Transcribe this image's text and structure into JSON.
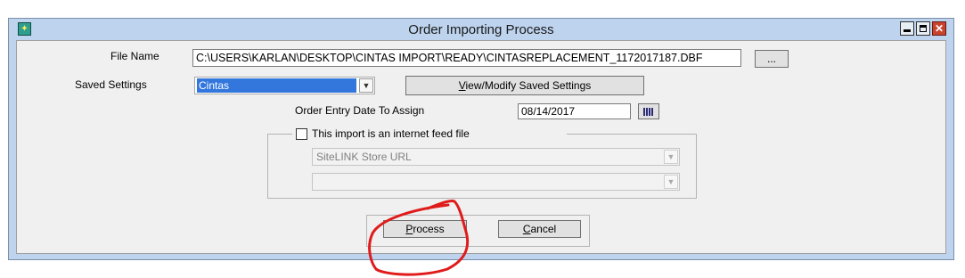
{
  "window": {
    "title": "Order Importing Process",
    "close_glyph": "✕"
  },
  "form": {
    "file_name_label": "File Name",
    "file_name_value": "C:\\USERS\\KARLAN\\DESKTOP\\CINTAS IMPORT\\READY\\CINTASREPLACEMENT_1172017187.DBF",
    "browse_label": "...",
    "saved_settings_label": "Saved Settings",
    "saved_settings_value": "Cintas",
    "view_modify_label_prefix": "V",
    "view_modify_label_rest": "iew/Modify Saved Settings",
    "order_date_label": "Order Entry Date To Assign",
    "order_date_value": "08/14/2017",
    "internet_feed_label": "This import is an internet feed file",
    "internet_feed_checked": false,
    "sitelink_value": "SiteLINK Store URL",
    "second_combo_value": ""
  },
  "buttons": {
    "process_prefix": "P",
    "process_rest": "rocess",
    "cancel_prefix": "C",
    "cancel_rest": "ancel"
  },
  "icons": {
    "app": "app-icon",
    "minimize": "minimize-icon",
    "maximize": "maximize-icon",
    "close": "close-icon",
    "calendar": "calendar-icon",
    "dropdown": "chevron-down-icon"
  },
  "colors": {
    "titlebar": "#bdd3ee",
    "client": "#f0f0f0",
    "selection": "#3377dd",
    "annotation": "#e01b1b"
  }
}
